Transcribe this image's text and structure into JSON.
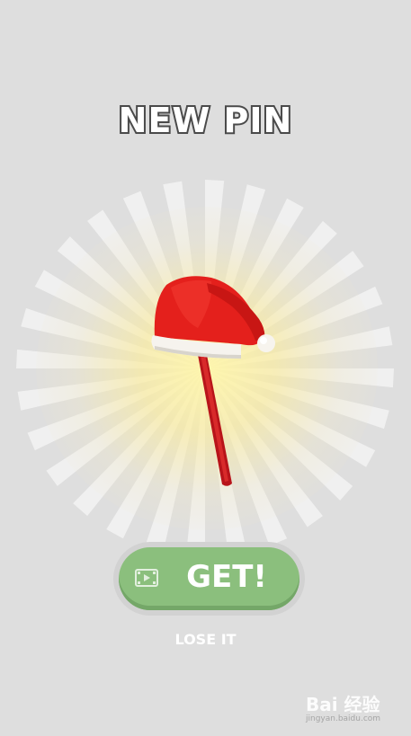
{
  "screen": {
    "title": "NEW PIN",
    "reward_item": "santa-hat-pin",
    "colors": {
      "background": "#dedede",
      "button": "#8bbf7d",
      "hat": "#e8211d",
      "glow": "#fff1a8"
    }
  },
  "actions": {
    "get_label": "GET!",
    "get_icon": "video-ad-icon",
    "lose_label": "LOSE IT"
  },
  "watermark": {
    "main": "Bai 经验",
    "sub": "jingyan.baidu.com"
  }
}
